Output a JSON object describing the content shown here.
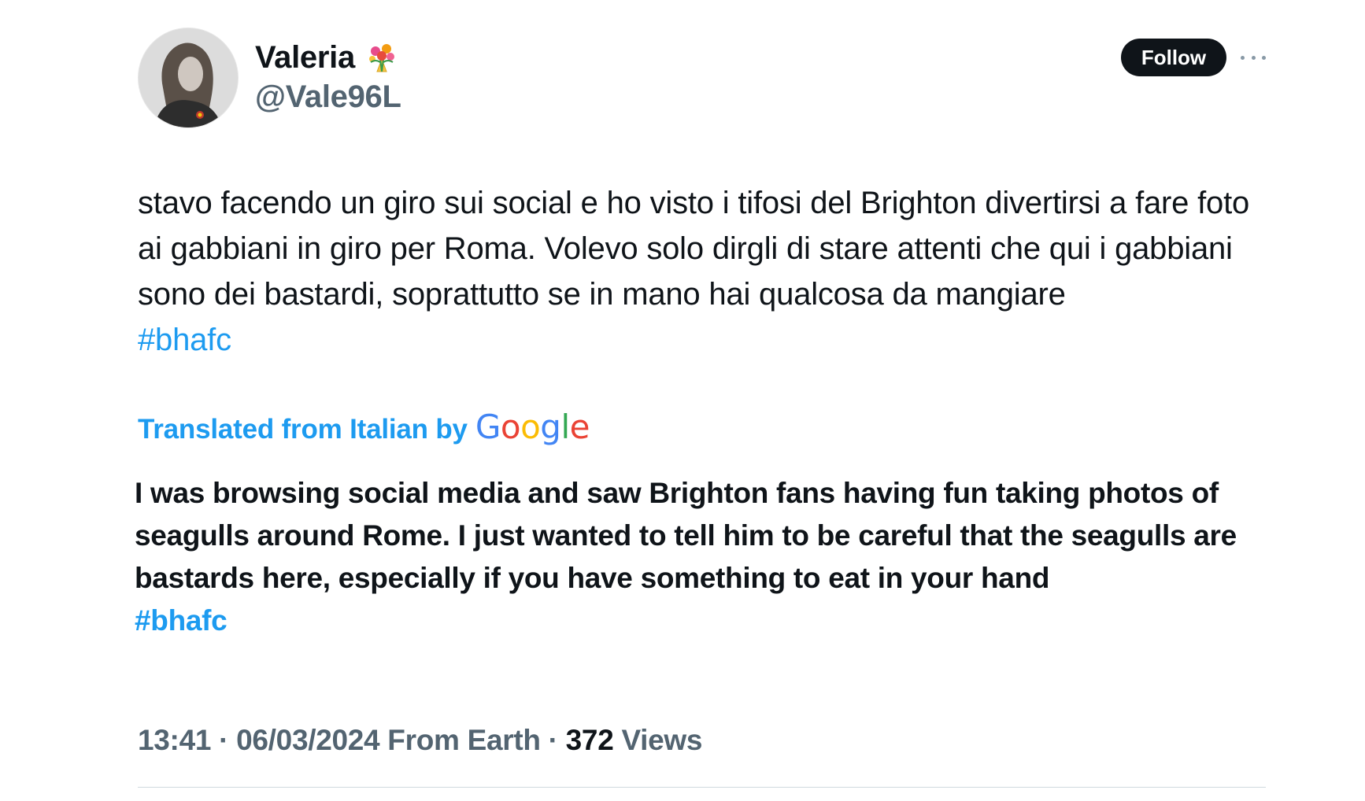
{
  "author": {
    "display_name": "Valeria",
    "name_emoji_icon": "bouquet-icon",
    "handle": "@Vale96L"
  },
  "actions": {
    "follow_label": "Follow",
    "more_icon": "more-horizontal-icon"
  },
  "tweet": {
    "text": "stavo facendo un giro sui social e ho visto i tifosi del Brighton divertirsi a fare foto ai gabbiani in giro per Roma. Volevo solo dirgli di stare attenti che qui i gabbiani sono dei bastardi, soprattutto se in mano hai qualcosa da mangiare",
    "hashtag": "#bhafc"
  },
  "translation": {
    "label": "Translated from Italian by",
    "provider": "Google",
    "text": "I was browsing social media and saw Brighton fans having fun taking photos of seagulls around Rome. I just wanted to tell him to be careful that the seagulls are bastards here, especially if you have something to eat in your hand",
    "hashtag": "#bhafc"
  },
  "meta": {
    "time": "13:41",
    "date": "06/03/2024",
    "source": "From Earth",
    "views_count": "372",
    "views_label": "Views"
  },
  "colors": {
    "link": "#1d9bf0",
    "text": "#0f1419",
    "secondary": "#536471",
    "button_bg": "#0f1419"
  }
}
